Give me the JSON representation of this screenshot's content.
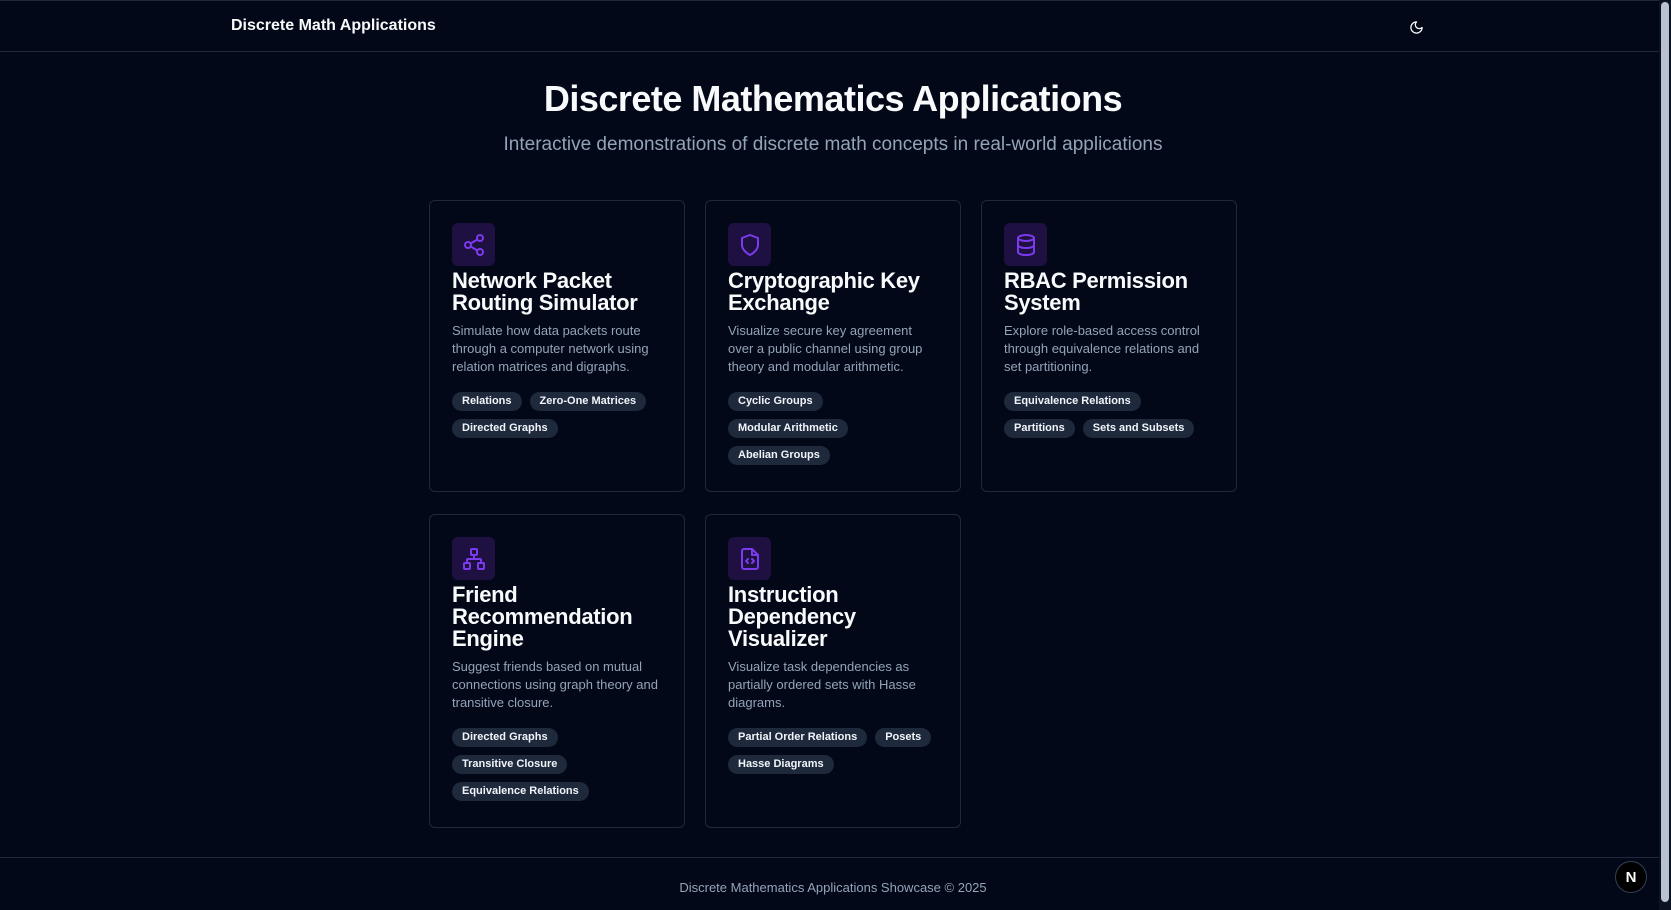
{
  "header": {
    "brand": "Discrete Math Applications",
    "theme_toggle_icon": "moon-icon"
  },
  "hero": {
    "title": "Discrete Mathematics Applications",
    "subtitle": "Interactive demonstrations of discrete math concepts in real-world applications"
  },
  "accent_color": "#7c3aed",
  "cards": [
    {
      "icon": "share-icon",
      "title": "Network Packet Routing Simulator",
      "description": "Simulate how data packets route through a computer network using relation matrices and digraphs.",
      "tags": [
        "Relations",
        "Zero-One Matrices",
        "Directed Graphs"
      ]
    },
    {
      "icon": "shield-icon",
      "title": "Cryptographic Key Exchange",
      "description": "Visualize secure key agreement over a public channel using group theory and modular arithmetic.",
      "tags": [
        "Cyclic Groups",
        "Modular Arithmetic",
        "Abelian Groups"
      ]
    },
    {
      "icon": "database-icon",
      "title": "RBAC Permission System",
      "description": "Explore role-based access control through equivalence relations and set partitioning.",
      "tags": [
        "Equivalence Relations",
        "Partitions",
        "Sets and Subsets"
      ]
    },
    {
      "icon": "network-icon",
      "title": "Friend Recommendation Engine",
      "description": "Suggest friends based on mutual connections using graph theory and transitive closure.",
      "tags": [
        "Directed Graphs",
        "Transitive Closure",
        "Equivalence Relations"
      ]
    },
    {
      "icon": "file-code-icon",
      "title": "Instruction Dependency Visualizer",
      "description": "Visualize task dependencies as partially ordered sets with Hasse diagrams.",
      "tags": [
        "Partial Order Relations",
        "Posets",
        "Hasse Diagrams"
      ]
    }
  ],
  "footer": {
    "text": "Discrete Mathematics Applications Showcase © 2025"
  },
  "dev_badge": {
    "label": "N"
  }
}
